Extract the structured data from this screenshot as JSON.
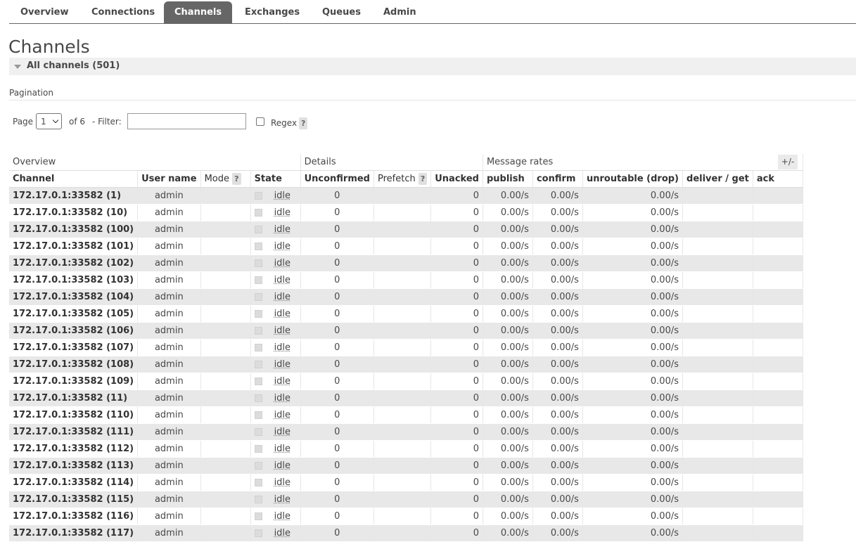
{
  "nav": {
    "tabs": [
      {
        "label": "Overview"
      },
      {
        "label": "Connections"
      },
      {
        "label": "Channels"
      },
      {
        "label": "Exchanges"
      },
      {
        "label": "Queues"
      },
      {
        "label": "Admin"
      }
    ],
    "active_index": 2
  },
  "page": {
    "title": "Channels",
    "section_label": "All channels (501)"
  },
  "pagination": {
    "heading": "Pagination",
    "page_label": "Page",
    "page_value": "1",
    "of_label": "of 6",
    "filter_label": "- Filter:",
    "filter_value": "",
    "regex_label": "Regex",
    "help_glyph": "?"
  },
  "table": {
    "groups": [
      "Overview",
      "Details",
      "Message rates"
    ],
    "columns": {
      "channel": "Channel",
      "user": "User name",
      "mode": "Mode",
      "state": "State",
      "unconfirmed": "Unconfirmed",
      "prefetch": "Prefetch",
      "unacked": "Unacked",
      "publish": "publish",
      "confirm": "confirm",
      "unroutable": "unroutable (drop)",
      "deliver": "deliver / get",
      "ack": "ack"
    },
    "toggle_label": "+/-",
    "rows": [
      {
        "channel": "172.17.0.1:33582 (1)",
        "user": "admin",
        "state": "idle",
        "unconfirmed": "0",
        "unacked": "0",
        "publish": "0.00/s",
        "confirm": "0.00/s",
        "unroutable": "0.00/s"
      },
      {
        "channel": "172.17.0.1:33582 (10)",
        "user": "admin",
        "state": "idle",
        "unconfirmed": "0",
        "unacked": "0",
        "publish": "0.00/s",
        "confirm": "0.00/s",
        "unroutable": "0.00/s"
      },
      {
        "channel": "172.17.0.1:33582 (100)",
        "user": "admin",
        "state": "idle",
        "unconfirmed": "0",
        "unacked": "0",
        "publish": "0.00/s",
        "confirm": "0.00/s",
        "unroutable": "0.00/s"
      },
      {
        "channel": "172.17.0.1:33582 (101)",
        "user": "admin",
        "state": "idle",
        "unconfirmed": "0",
        "unacked": "0",
        "publish": "0.00/s",
        "confirm": "0.00/s",
        "unroutable": "0.00/s"
      },
      {
        "channel": "172.17.0.1:33582 (102)",
        "user": "admin",
        "state": "idle",
        "unconfirmed": "0",
        "unacked": "0",
        "publish": "0.00/s",
        "confirm": "0.00/s",
        "unroutable": "0.00/s"
      },
      {
        "channel": "172.17.0.1:33582 (103)",
        "user": "admin",
        "state": "idle",
        "unconfirmed": "0",
        "unacked": "0",
        "publish": "0.00/s",
        "confirm": "0.00/s",
        "unroutable": "0.00/s"
      },
      {
        "channel": "172.17.0.1:33582 (104)",
        "user": "admin",
        "state": "idle",
        "unconfirmed": "0",
        "unacked": "0",
        "publish": "0.00/s",
        "confirm": "0.00/s",
        "unroutable": "0.00/s"
      },
      {
        "channel": "172.17.0.1:33582 (105)",
        "user": "admin",
        "state": "idle",
        "unconfirmed": "0",
        "unacked": "0",
        "publish": "0.00/s",
        "confirm": "0.00/s",
        "unroutable": "0.00/s"
      },
      {
        "channel": "172.17.0.1:33582 (106)",
        "user": "admin",
        "state": "idle",
        "unconfirmed": "0",
        "unacked": "0",
        "publish": "0.00/s",
        "confirm": "0.00/s",
        "unroutable": "0.00/s"
      },
      {
        "channel": "172.17.0.1:33582 (107)",
        "user": "admin",
        "state": "idle",
        "unconfirmed": "0",
        "unacked": "0",
        "publish": "0.00/s",
        "confirm": "0.00/s",
        "unroutable": "0.00/s"
      },
      {
        "channel": "172.17.0.1:33582 (108)",
        "user": "admin",
        "state": "idle",
        "unconfirmed": "0",
        "unacked": "0",
        "publish": "0.00/s",
        "confirm": "0.00/s",
        "unroutable": "0.00/s"
      },
      {
        "channel": "172.17.0.1:33582 (109)",
        "user": "admin",
        "state": "idle",
        "unconfirmed": "0",
        "unacked": "0",
        "publish": "0.00/s",
        "confirm": "0.00/s",
        "unroutable": "0.00/s"
      },
      {
        "channel": "172.17.0.1:33582 (11)",
        "user": "admin",
        "state": "idle",
        "unconfirmed": "0",
        "unacked": "0",
        "publish": "0.00/s",
        "confirm": "0.00/s",
        "unroutable": "0.00/s"
      },
      {
        "channel": "172.17.0.1:33582 (110)",
        "user": "admin",
        "state": "idle",
        "unconfirmed": "0",
        "unacked": "0",
        "publish": "0.00/s",
        "confirm": "0.00/s",
        "unroutable": "0.00/s"
      },
      {
        "channel": "172.17.0.1:33582 (111)",
        "user": "admin",
        "state": "idle",
        "unconfirmed": "0",
        "unacked": "0",
        "publish": "0.00/s",
        "confirm": "0.00/s",
        "unroutable": "0.00/s"
      },
      {
        "channel": "172.17.0.1:33582 (112)",
        "user": "admin",
        "state": "idle",
        "unconfirmed": "0",
        "unacked": "0",
        "publish": "0.00/s",
        "confirm": "0.00/s",
        "unroutable": "0.00/s"
      },
      {
        "channel": "172.17.0.1:33582 (113)",
        "user": "admin",
        "state": "idle",
        "unconfirmed": "0",
        "unacked": "0",
        "publish": "0.00/s",
        "confirm": "0.00/s",
        "unroutable": "0.00/s"
      },
      {
        "channel": "172.17.0.1:33582 (114)",
        "user": "admin",
        "state": "idle",
        "unconfirmed": "0",
        "unacked": "0",
        "publish": "0.00/s",
        "confirm": "0.00/s",
        "unroutable": "0.00/s"
      },
      {
        "channel": "172.17.0.1:33582 (115)",
        "user": "admin",
        "state": "idle",
        "unconfirmed": "0",
        "unacked": "0",
        "publish": "0.00/s",
        "confirm": "0.00/s",
        "unroutable": "0.00/s"
      },
      {
        "channel": "172.17.0.1:33582 (116)",
        "user": "admin",
        "state": "idle",
        "unconfirmed": "0",
        "unacked": "0",
        "publish": "0.00/s",
        "confirm": "0.00/s",
        "unroutable": "0.00/s"
      },
      {
        "channel": "172.17.0.1:33582 (117)",
        "user": "admin",
        "state": "idle",
        "unconfirmed": "0",
        "unacked": "0",
        "publish": "0.00/s",
        "confirm": "0.00/s",
        "unroutable": "0.00/s"
      }
    ]
  },
  "colors": {
    "active_tab_bg": "#666666",
    "row_alt_bg": "#e8e8e8",
    "text": "#484848"
  }
}
